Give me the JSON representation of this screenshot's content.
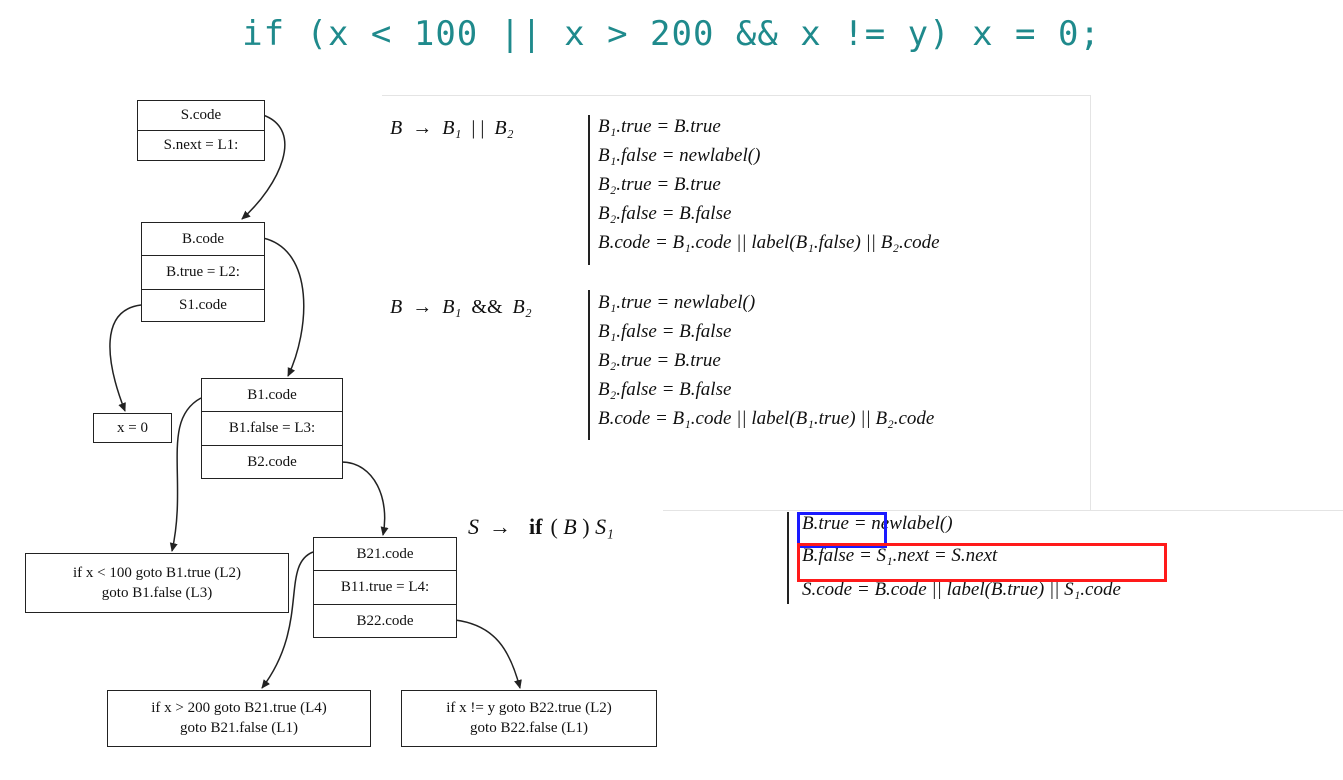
{
  "title": "if (x < 100 || x > 200 && x != y) x = 0;",
  "tree": {
    "s": [
      "S.code",
      "S.next = L1:"
    ],
    "b": [
      "B.code",
      "B.true = L2:",
      "S1.code"
    ],
    "x0": "x = 0",
    "b1": [
      "B1.code",
      "B1.false = L3:",
      "B2.code"
    ],
    "b2": [
      "B21.code",
      "B11.true = L4:",
      "B22.code"
    ],
    "n1": [
      "if x < 100 goto B1.true (L2)",
      "goto B1.false (L3)"
    ],
    "n2": [
      "if x > 200 goto B21.true (L4)",
      "goto B21.false (L1)"
    ],
    "n3": [
      "if x != y goto B22.true (L2)",
      "goto B22.false (L1)"
    ]
  },
  "rules": {
    "or": {
      "head": {
        "lhs": "B",
        "arrow": "→",
        "rhs1": "B₁",
        "op": "| |",
        "rhs2": "B₂"
      },
      "actions": [
        "B₁.true = B.true",
        "B₁.false = newlabel()",
        "B₂.true = B.true",
        "B₂.false = B.false",
        "B.code = B₁.code || label(B₁.false) || B₂.code"
      ]
    },
    "and": {
      "head": {
        "lhs": "B",
        "arrow": "→",
        "rhs1": "B₁",
        "op": "&&",
        "rhs2": "B₂"
      },
      "actions": [
        "B₁.true = newlabel()",
        "B₁.false = B.false",
        "B₂.true = B.true",
        "B₂.false = B.false",
        "B.code = B₁.code || label(B₁.true) || B₂.code"
      ]
    },
    "if": {
      "head": {
        "lhs": "S",
        "arrow": "→",
        "kw": "if",
        "lp": "(",
        "b": "B",
        "rp": ")",
        "s1": "S₁"
      },
      "actions": [
        "B.true = newlabel()",
        "B.false = S₁.next = S.next",
        "S.code = B.code || label(B.true) || S₁.code"
      ]
    }
  },
  "colors": {
    "title": "#1f8a8c",
    "highlight_true": "#1a1aff",
    "highlight_false": "#ff1a1a"
  }
}
